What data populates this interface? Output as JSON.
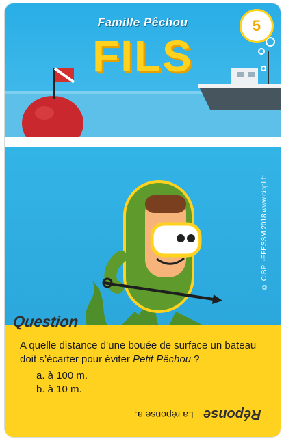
{
  "card": {
    "family": "Famille Pêchou",
    "title": "FILS",
    "number": "5",
    "copyright": "© CIBPL-FFESSM 2018 www.cibpl.fr"
  },
  "question": {
    "label": "Question",
    "text_before": "A quelle distance d’une bouée de surface un bateau doit s’écarter pour éviter ",
    "text_italic": "Petit Pêchou",
    "text_after": " ?",
    "options": [
      "a. à 100 m.",
      "b. à 10 m."
    ]
  },
  "answer": {
    "title": "Réponse",
    "hint": "La réponse a."
  },
  "colors": {
    "accent_yellow": "#ffd21f",
    "sea_blue": "#2ba7dc",
    "buoy_red": "#c8282e",
    "diver_green": "#5f9b2c"
  }
}
